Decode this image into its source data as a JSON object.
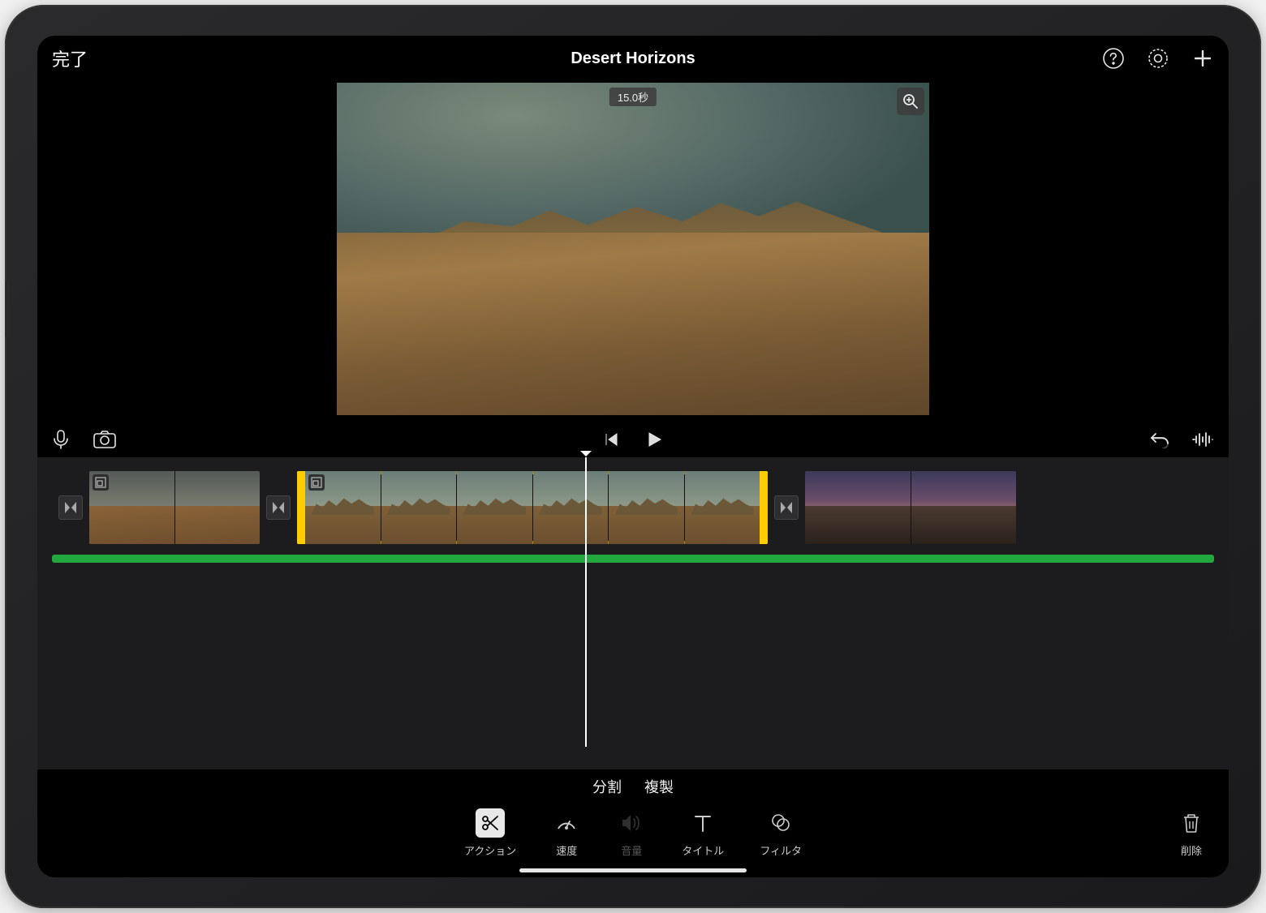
{
  "header": {
    "done_label": "完了",
    "project_title": "Desert Horizons"
  },
  "preview": {
    "duration_label": "15.0秒"
  },
  "context_actions": {
    "split": "分割",
    "duplicate": "複製"
  },
  "tools": {
    "action": "アクション",
    "speed": "速度",
    "volume": "音量",
    "title": "タイトル",
    "filter": "フィルタ",
    "delete": "削除"
  },
  "icons": {
    "help": "help-icon",
    "settings": "gear-icon",
    "add": "plus-icon",
    "zoom_in": "magnify-plus-icon",
    "mic": "microphone-icon",
    "camera": "camera-icon",
    "skip_start": "skip-back-icon",
    "play": "play-icon",
    "undo": "undo-icon",
    "waveform": "waveform-icon",
    "transition": "transition-icon",
    "kenburns": "kenburns-icon",
    "scissors": "scissors-icon",
    "speedometer": "speedometer-icon",
    "speaker": "speaker-icon",
    "text": "text-icon",
    "filter_circles": "filter-icon",
    "trash": "trash-icon"
  }
}
